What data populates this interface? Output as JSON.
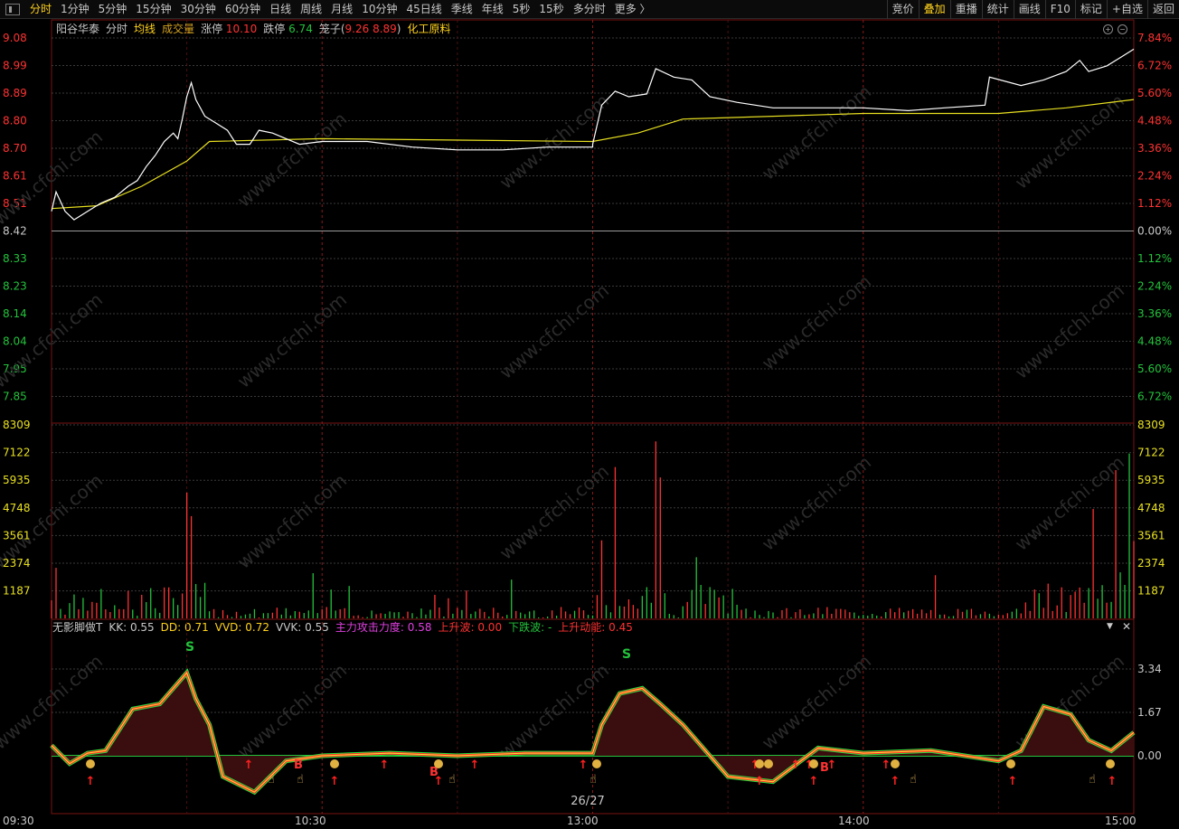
{
  "toolbar": {
    "periods": [
      "分时",
      "1分钟",
      "5分钟",
      "15分钟",
      "30分钟",
      "60分钟",
      "日线",
      "周线",
      "月线",
      "10分钟",
      "45日线",
      "季线",
      "年线",
      "5秒",
      "15秒",
      "多分时",
      "更多 〉"
    ],
    "active_period": "分时",
    "tools": [
      "竞价",
      "叠加",
      "重播",
      "统计",
      "画线",
      "F10",
      "标记",
      "+自选",
      "返回"
    ],
    "active_tool": "叠加"
  },
  "info": {
    "stock_name": "阳谷华泰",
    "chart_mode": "分时",
    "avg_line_label": "均线",
    "volume_label": "成交量",
    "limit_up_label": "涨停",
    "limit_up_value": "10.10",
    "limit_down_label": "跌停",
    "limit_down_value": "6.74",
    "basket_label": "笼子",
    "basket_value_a": "9.26",
    "basket_value_b": "8.89",
    "sector": "化工原料"
  },
  "price_axis": {
    "left": [
      "9.08",
      "8.99",
      "8.89",
      "8.80",
      "8.70",
      "8.61",
      "8.51",
      "8.42",
      "8.33",
      "8.23",
      "8.14",
      "8.04",
      "7.95",
      "7.85"
    ],
    "right": [
      "7.84%",
      "6.72%",
      "5.60%",
      "4.48%",
      "3.36%",
      "2.24%",
      "1.12%",
      "0.00%",
      "1.12%",
      "2.24%",
      "3.36%",
      "4.48%",
      "5.60%",
      "6.72%"
    ]
  },
  "volume_axis": [
    "8309",
    "7122",
    "5935",
    "4748",
    "3561",
    "2374",
    "1187"
  ],
  "indicator": {
    "name": "无影脚做T",
    "kk_label": "KK:",
    "kk": "0.55",
    "dd_label": "DD:",
    "dd": "0.71",
    "vvd_label": "VVD:",
    "vvd": "0.72",
    "vvk_label": "VVK:",
    "vvk": "0.55",
    "attack_label": "主力攻击力度:",
    "attack": "0.58",
    "rise_label": "上升波:",
    "rise": "0.00",
    "fall_label": "下跌波:",
    "fall": "-",
    "energy_label": "上升动能:",
    "energy": "0.45",
    "axis": [
      "3.34",
      "1.67",
      "0.00"
    ],
    "s_marks": [
      "S",
      "S"
    ],
    "b_marks": [
      "B",
      "B",
      "B"
    ]
  },
  "time_axis": [
    "09:30",
    "10:30",
    "13:00",
    "14:00",
    "15:00"
  ],
  "page_indicator": "26/27",
  "watermark": "www.cfchi.com",
  "colors": {
    "price_line": "#ffffff",
    "avg_line": "#e8e020",
    "up": "#ff3232",
    "down": "#23c23c",
    "grid": "#3a3a3a",
    "vgrid": "#7a1212",
    "axis_up": "#ff3232",
    "axis_down": "#23c23c",
    "neutral": "#c8c8c8"
  },
  "chart_data": {
    "type": "line",
    "x_range": [
      "09:30",
      "15:00"
    ],
    "prev_close": 8.42,
    "price_ylim": [
      7.8,
      9.08
    ],
    "price_series": [
      [
        "09:30",
        8.46
      ],
      [
        "09:31",
        8.53
      ],
      [
        "09:33",
        8.46
      ],
      [
        "09:35",
        8.43
      ],
      [
        "09:38",
        8.46
      ],
      [
        "09:41",
        8.49
      ],
      [
        "09:44",
        8.51
      ],
      [
        "09:47",
        8.55
      ],
      [
        "09:49",
        8.57
      ],
      [
        "09:51",
        8.62
      ],
      [
        "09:53",
        8.66
      ],
      [
        "09:55",
        8.71
      ],
      [
        "09:57",
        8.74
      ],
      [
        "09:58",
        8.72
      ],
      [
        "09:59",
        8.79
      ],
      [
        "10:00",
        8.87
      ],
      [
        "10:01",
        8.92
      ],
      [
        "10:02",
        8.86
      ],
      [
        "10:04",
        8.8
      ],
      [
        "10:06",
        8.78
      ],
      [
        "10:09",
        8.75
      ],
      [
        "10:11",
        8.7
      ],
      [
        "10:14",
        8.7
      ],
      [
        "10:16",
        8.75
      ],
      [
        "10:19",
        8.74
      ],
      [
        "10:22",
        8.72
      ],
      [
        "10:25",
        8.7
      ],
      [
        "10:30",
        8.71
      ],
      [
        "10:40",
        8.71
      ],
      [
        "10:50",
        8.69
      ],
      [
        "11:00",
        8.68
      ],
      [
        "11:10",
        8.68
      ],
      [
        "11:20",
        8.69
      ],
      [
        "11:30",
        8.69
      ],
      [
        "13:00",
        8.7
      ],
      [
        "13:02",
        8.84
      ],
      [
        "13:05",
        8.89
      ],
      [
        "13:08",
        8.87
      ],
      [
        "13:12",
        8.88
      ],
      [
        "13:14",
        8.97
      ],
      [
        "13:18",
        8.94
      ],
      [
        "13:22",
        8.93
      ],
      [
        "13:26",
        8.87
      ],
      [
        "13:32",
        8.85
      ],
      [
        "13:40",
        8.83
      ],
      [
        "13:50",
        8.83
      ],
      [
        "14:00",
        8.83
      ],
      [
        "14:10",
        8.82
      ],
      [
        "14:18",
        8.83
      ],
      [
        "14:27",
        8.84
      ],
      [
        "14:28",
        8.94
      ],
      [
        "14:35",
        8.91
      ],
      [
        "14:40",
        8.93
      ],
      [
        "14:45",
        8.96
      ],
      [
        "14:48",
        9.0
      ],
      [
        "14:50",
        8.96
      ],
      [
        "14:54",
        8.98
      ],
      [
        "14:57",
        9.01
      ],
      [
        "15:00",
        9.04
      ]
    ],
    "avg_series": [
      [
        "09:30",
        8.47
      ],
      [
        "09:40",
        8.48
      ],
      [
        "09:50",
        8.55
      ],
      [
        "10:00",
        8.64
      ],
      [
        "10:05",
        8.71
      ],
      [
        "10:30",
        8.72
      ],
      [
        "11:30",
        8.71
      ],
      [
        "13:00",
        8.71
      ],
      [
        "13:10",
        8.74
      ],
      [
        "13:20",
        8.79
      ],
      [
        "14:00",
        8.81
      ],
      [
        "14:30",
        8.81
      ],
      [
        "14:45",
        8.83
      ],
      [
        "15:00",
        8.86
      ]
    ],
    "volume_ylim": [
      0,
      8309
    ],
    "volume_peaks": [
      [
        "09:31",
        2170,
        "up"
      ],
      [
        "10:00",
        5400,
        "up"
      ],
      [
        "10:01",
        4390,
        "up"
      ],
      [
        "13:02",
        3350,
        "up"
      ],
      [
        "13:05",
        6500,
        "up"
      ],
      [
        "13:14",
        7600,
        "up"
      ],
      [
        "13:15",
        6050,
        "up"
      ],
      [
        "14:51",
        4700,
        "up"
      ],
      [
        "14:56",
        6370,
        "up"
      ],
      [
        "14:59",
        7080,
        "down"
      ],
      [
        "15:00",
        3320,
        "up"
      ]
    ]
  }
}
